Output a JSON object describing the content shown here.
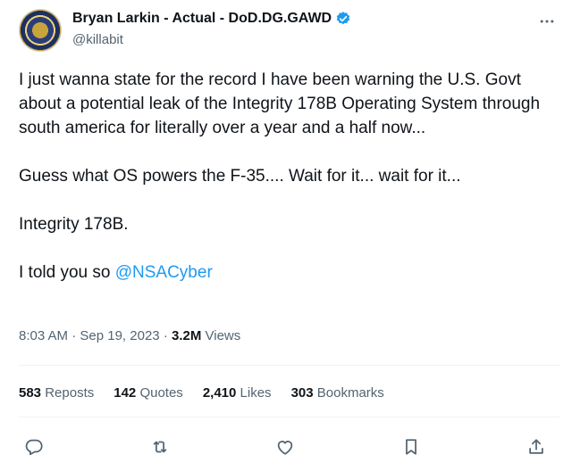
{
  "author": {
    "display_name": "Bryan Larkin - Actual - DoD.DG.GAWD",
    "handle": "@killabit",
    "verified": true
  },
  "tweet": {
    "paragraphs": [
      "I just wanna state for the record I have been warning the U.S. Govt about a potential leak of the Integrity 178B Operating System through south america for literally over a year and a half now...",
      "Guess what OS powers the F-35.... Wait for it... wait for it...",
      "Integrity 178B."
    ],
    "last_line_prefix": "I told you so ",
    "mention": "@NSACyber"
  },
  "meta": {
    "time": "8:03 AM",
    "separator": "·",
    "date": "Sep 19, 2023",
    "views_count": "3.2M",
    "views_label": "Views"
  },
  "stats": {
    "reposts_count": "583",
    "reposts_label": "Reposts",
    "quotes_count": "142",
    "quotes_label": "Quotes",
    "likes_count": "2,410",
    "likes_label": "Likes",
    "bookmarks_count": "303",
    "bookmarks_label": "Bookmarks"
  },
  "colors": {
    "accent": "#1d9bf0",
    "secondary_text": "#536471",
    "primary_text": "#0f1419"
  },
  "icons": [
    "more-icon",
    "verified-icon",
    "reply-icon",
    "repost-icon",
    "like-icon",
    "bookmark-icon",
    "share-icon"
  ]
}
